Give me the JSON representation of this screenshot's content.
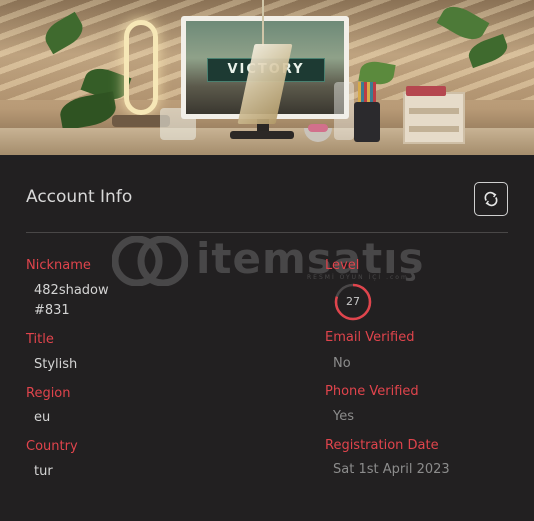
{
  "banner": {
    "monitor_text": "VICTORY"
  },
  "panel": {
    "title": "Account Info",
    "refresh_icon": "refresh-icon"
  },
  "watermark": {
    "brand": "itemsatış",
    "tagline": "RESMİ OYUN İÇİ .com"
  },
  "fields": {
    "nickname": {
      "label": "Nickname",
      "value_line1": "482shadow",
      "value_line2": "#831"
    },
    "title": {
      "label": "Title",
      "value": "Stylish"
    },
    "region": {
      "label": "Region",
      "value": "eu"
    },
    "country": {
      "label": "Country",
      "value": "tur"
    },
    "level": {
      "label": "Level",
      "value": "27",
      "progress": 0.8
    },
    "email_verified": {
      "label": "Email Verified",
      "value": "No"
    },
    "phone_verified": {
      "label": "Phone Verified",
      "value": "Yes"
    },
    "registration_date": {
      "label": "Registration Date",
      "value": "Sat 1st April 2023"
    }
  },
  "colors": {
    "background": "#222021",
    "label": "#e0444c",
    "ring": "#e0444c"
  }
}
